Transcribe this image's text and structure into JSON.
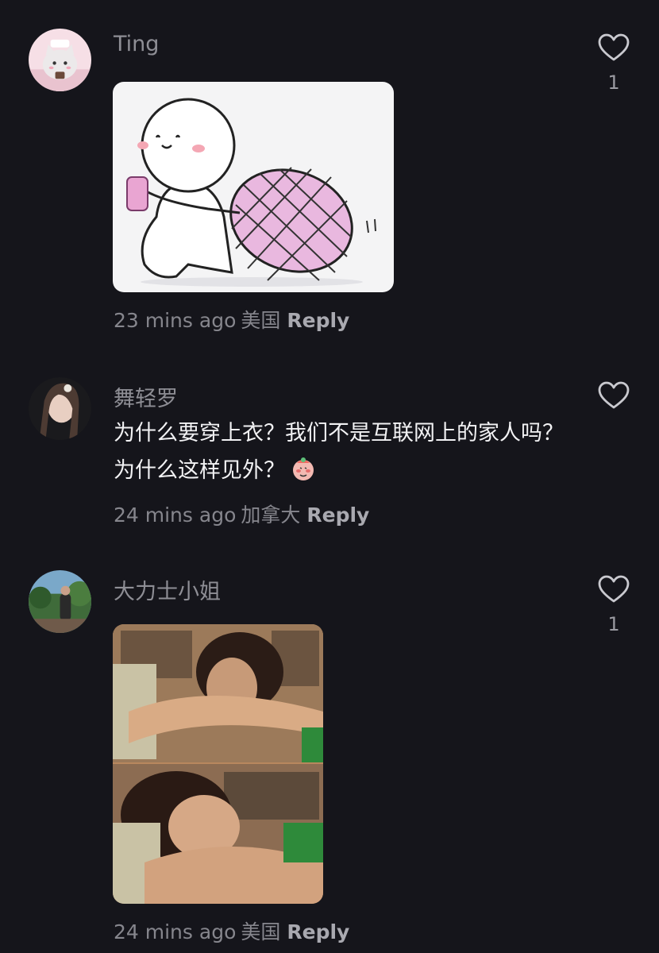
{
  "comments": [
    {
      "username": "Ting",
      "text": "",
      "time": "23 mins ago",
      "location": "美国",
      "reply_label": "Reply",
      "likes": "1"
    },
    {
      "username": "舞轻罗",
      "text": "为什么要穿上衣？我们不是互联网上的家人吗？为什么这样见外？",
      "time": "24 mins ago",
      "location": "加拿大",
      "reply_label": "Reply",
      "likes": ""
    },
    {
      "username": "大力士小姐",
      "text": "",
      "time": "24 mins ago",
      "location": "美国",
      "reply_label": "Reply",
      "likes": "1"
    }
  ],
  "icons": {
    "like": "heart-outline-icon"
  },
  "colors": {
    "background": "#15151b",
    "username": "#8e8e95",
    "meta": "#86868d",
    "reply": "#a9a9b0",
    "body_text": "#f2f2f4"
  }
}
